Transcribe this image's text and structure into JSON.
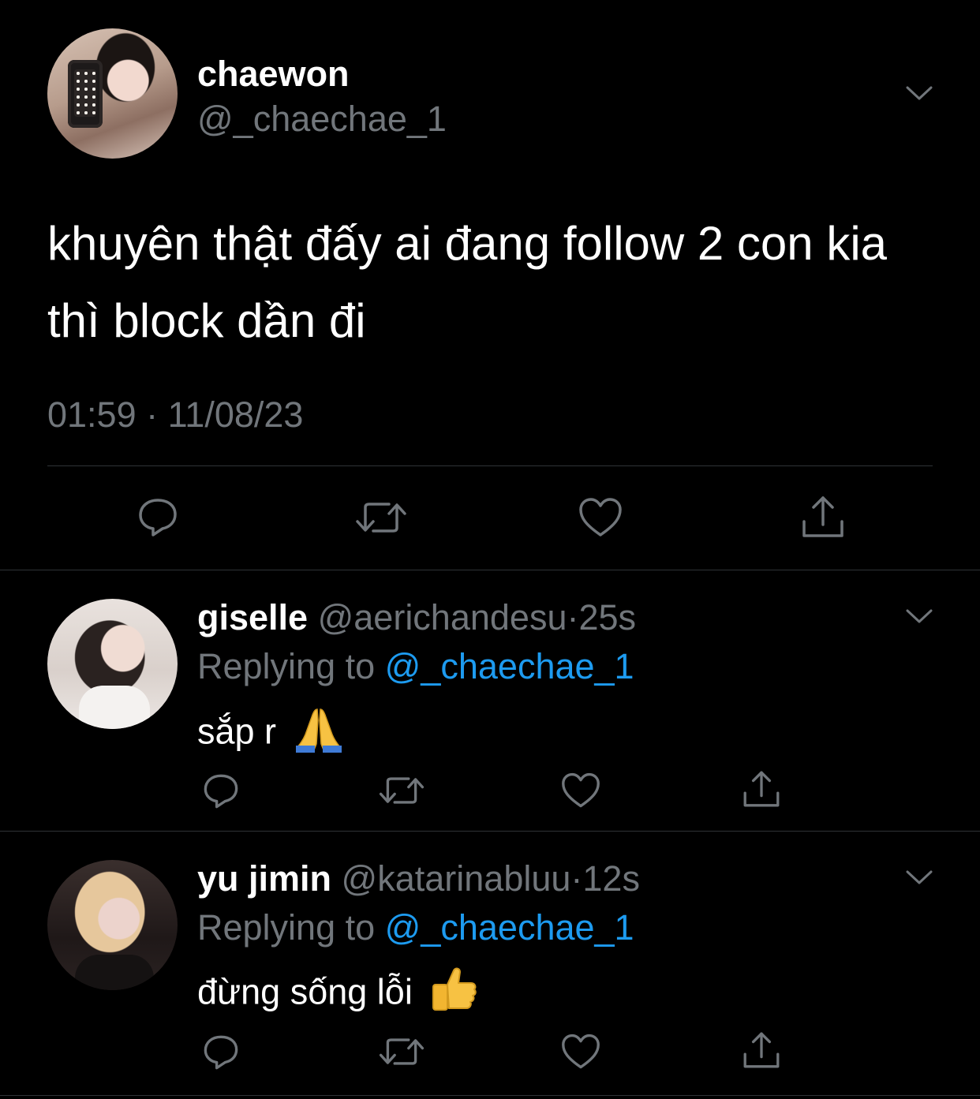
{
  "main_tweet": {
    "display_name": "chaewon",
    "handle": "@_chaechae_1",
    "text": "khuyên thật đấy ai đang follow 2 con kia thì block dần đi",
    "timestamp": "01:59 · 11/08/23",
    "actions": [
      "reply-icon",
      "retweet-icon",
      "like-icon",
      "share-icon"
    ]
  },
  "replies": [
    {
      "display_name": "giselle",
      "handle": "@aerichandesu",
      "dot": "·",
      "time": "25s",
      "replying_prefix": "Replying to",
      "replying_to": "@_chaechae_1",
      "text": "sắp r",
      "emoji": "folded-hands-emoji"
    },
    {
      "display_name": "yu jimin",
      "handle": "@katarinabluu",
      "dot": "·",
      "time": "12s",
      "replying_prefix": "Replying to",
      "replying_to": "@_chaechae_1",
      "text": "đừng sống lỗi",
      "emoji": "thumbs-up-emoji"
    }
  ],
  "colors": {
    "background": "#000000",
    "primary_text": "#ffffff",
    "secondary_text": "#71767b",
    "link": "#1d9bf0",
    "divider": "#2f3336"
  }
}
